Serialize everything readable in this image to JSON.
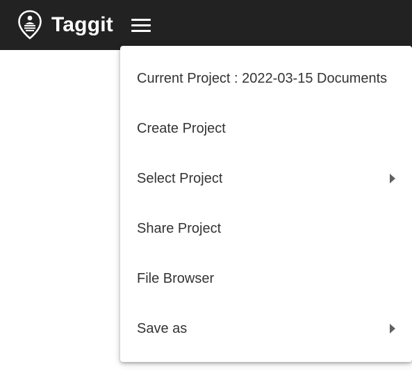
{
  "app": {
    "name": "Taggit",
    "logo_icon": "location-pin-icon",
    "menu_icon": "hamburger-menu-icon"
  },
  "colors": {
    "topbar": "#222222",
    "menu_text": "#333333",
    "caret": "#616161"
  },
  "menu": {
    "items": [
      {
        "label": "Current Project : 2022-03-15 Documents",
        "has_submenu": false
      },
      {
        "label": "Create Project",
        "has_submenu": false
      },
      {
        "label": "Select Project",
        "has_submenu": true,
        "icon": "chevron-right-icon"
      },
      {
        "label": "Share Project",
        "has_submenu": false
      },
      {
        "label": "File Browser",
        "has_submenu": false
      },
      {
        "label": "Save as",
        "has_submenu": true,
        "icon": "chevron-right-icon"
      }
    ]
  }
}
